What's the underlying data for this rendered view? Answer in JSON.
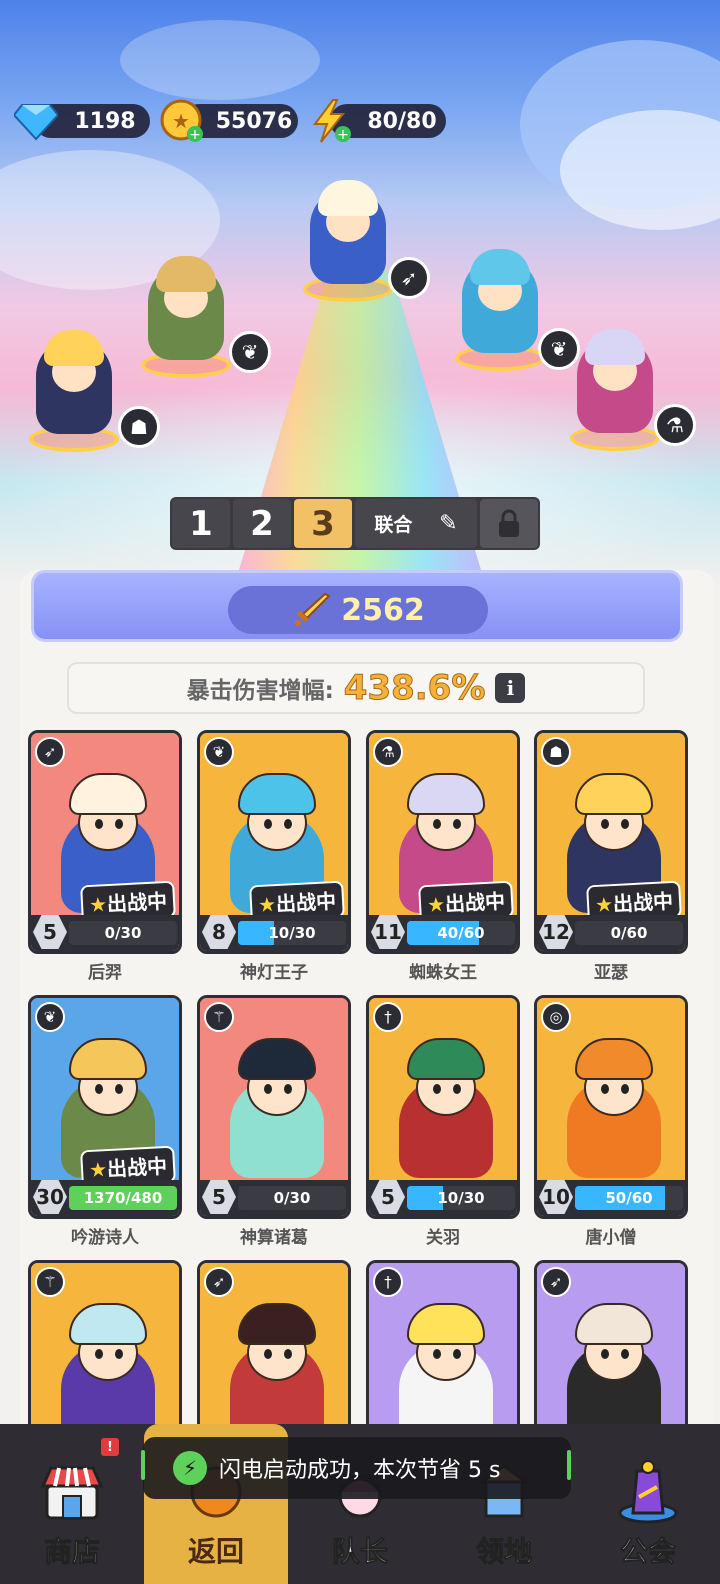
{
  "resources": {
    "gems": "1198",
    "coins": "55076",
    "energy": "80/80"
  },
  "team_tabs": {
    "tab1": "1",
    "tab2": "2",
    "tab3": "3",
    "union": "联合",
    "active": "3"
  },
  "power": "2562",
  "crit": {
    "label": "暴击伤害增幅:",
    "value": "438.6%",
    "info": "i"
  },
  "deploy_label": "出战中",
  "heroes": [
    {
      "name": "后羿",
      "level": "5",
      "xp": "0/30",
      "xp_fraction": 0.0,
      "class_icon": "bow-icon",
      "deployed": true,
      "bg": "#f3897e"
    },
    {
      "name": "神灯王子",
      "level": "8",
      "xp": "10/30",
      "xp_fraction": 0.33,
      "class_icon": "wings-icon",
      "deployed": true,
      "bg": "#f6b53c"
    },
    {
      "name": "蜘蛛女王",
      "level": "11",
      "xp": "40/60",
      "xp_fraction": 0.67,
      "class_icon": "potion-icon",
      "deployed": true,
      "bg": "#f6b53c"
    },
    {
      "name": "亚瑟",
      "level": "12",
      "xp": "0/60",
      "xp_fraction": 0.0,
      "class_icon": "helmet-icon",
      "deployed": true,
      "bg": "#f6b53c"
    },
    {
      "name": "吟游诗人",
      "level": "30",
      "xp": "1370/480",
      "xp_fraction": 1.0,
      "class_icon": "wings-icon",
      "deployed": true,
      "bg": "#5aa6e8"
    },
    {
      "name": "神算诸葛",
      "level": "5",
      "xp": "0/30",
      "xp_fraction": 0.0,
      "class_icon": "staff-icon",
      "deployed": false,
      "bg": "#f3897e"
    },
    {
      "name": "关羽",
      "level": "5",
      "xp": "10/30",
      "xp_fraction": 0.33,
      "class_icon": "sword-icon",
      "deployed": false,
      "bg": "#f6b53c"
    },
    {
      "name": "唐小僧",
      "level": "10",
      "xp": "50/60",
      "xp_fraction": 0.83,
      "class_icon": "spiral-icon",
      "deployed": false,
      "bg": "#f6b53c"
    },
    {
      "name": "",
      "level": "",
      "xp": "",
      "class_icon": "staff-icon",
      "deployed": false,
      "bg": "#f6b53c"
    },
    {
      "name": "",
      "level": "",
      "xp": "",
      "class_icon": "bow-icon",
      "deployed": false,
      "bg": "#f6b53c"
    },
    {
      "name": "",
      "level": "",
      "xp": "",
      "class_icon": "sword-icon",
      "deployed": false,
      "bg": "#b79cf0"
    },
    {
      "name": "",
      "level": "",
      "xp": "",
      "class_icon": "bow-icon",
      "deployed": false,
      "bg": "#b79cf0"
    }
  ],
  "nav": {
    "shop": "商店",
    "back": "返回",
    "captain": "队长",
    "territory": "领地",
    "guild": "公会",
    "shop_badge": "!"
  },
  "toast": "闪电启动成功，本次节省 5 s"
}
